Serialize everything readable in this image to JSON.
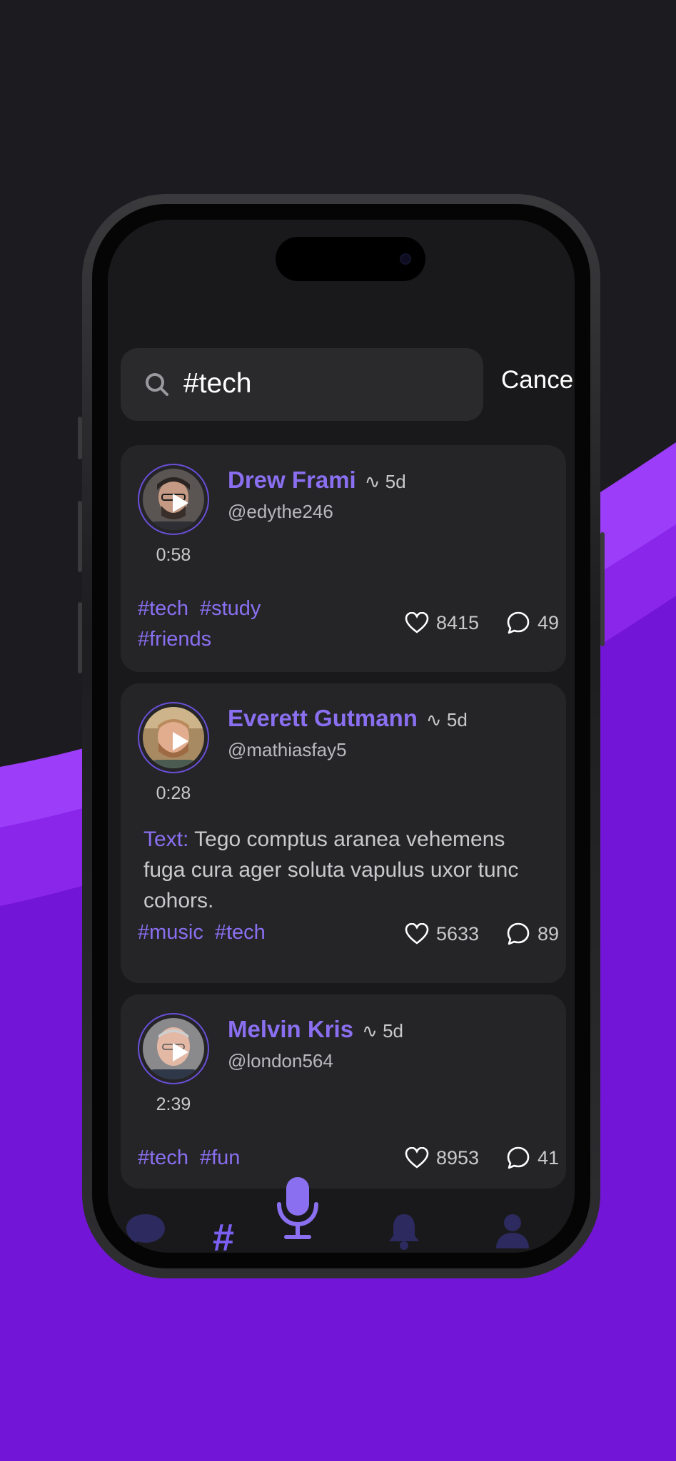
{
  "colors": {
    "accent": "#8a6ff0",
    "brand_purple": "#7315d6",
    "card": "#252528",
    "inactive_tab": "#2c2a5e"
  },
  "search": {
    "query": "#tech",
    "cancel_label": "Cancel",
    "icon": "search-icon"
  },
  "posts": [
    {
      "name": "Drew Frami",
      "age": "5d",
      "handle": "@edythe246",
      "duration": "0:58",
      "text_label": "",
      "text": "",
      "tags": [
        "#tech",
        "#study",
        "#friends"
      ],
      "likes": "8415",
      "comments": "49"
    },
    {
      "name": "Everett Gutmann",
      "age": "5d",
      "handle": "@mathiasfay5",
      "duration": "0:28",
      "text_label": "Text:",
      "text": "Tego comptus aranea vehemens fuga cura ager soluta vapulus uxor tunc cohors.",
      "tags": [
        "#music",
        "#tech"
      ],
      "likes": "5633",
      "comments": "89"
    },
    {
      "name": "Melvin Kris",
      "age": "5d",
      "handle": "@london564",
      "duration": "2:39",
      "text_label": "",
      "text": "",
      "tags": [
        "#tech",
        "#fun"
      ],
      "likes": "8953",
      "comments": "41"
    }
  ],
  "tabbar": {
    "items": [
      {
        "icon": "chat-bubble-icon",
        "active": false
      },
      {
        "icon": "hashtag-icon",
        "glyph": "#",
        "active": true
      },
      {
        "icon": "microphone-icon",
        "active": true
      },
      {
        "icon": "bell-icon",
        "active": false
      },
      {
        "icon": "profile-icon",
        "active": false
      }
    ]
  }
}
